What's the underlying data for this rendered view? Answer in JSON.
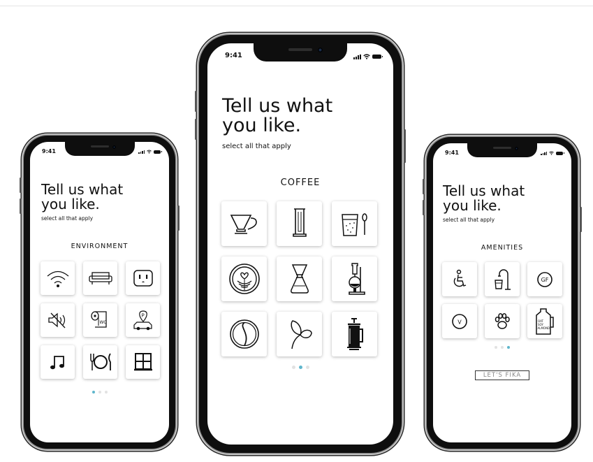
{
  "phones": {
    "left": {
      "time": "9:41",
      "title_line1": "Tell us what",
      "title_line2": "you like.",
      "subtitle": "select all that apply",
      "section": "ENVIRONMENT",
      "icons": [
        "wifi-icon",
        "sofa-icon",
        "outlet-icon",
        "mute-icon",
        "toilet-paper-icon",
        "parking-icon",
        "music-note-icon",
        "dining-icon",
        "window-icon"
      ],
      "wc_text": "WC",
      "parking_text": "P",
      "page": 1,
      "pages": 3
    },
    "center": {
      "time": "9:41",
      "title_line1": "Tell us what",
      "title_line2": "you like.",
      "subtitle": "select all that apply",
      "section": "COFFEE",
      "icons": [
        "pour-over-icon",
        "aeropress-icon",
        "cold-brew-icon",
        "latte-art-icon",
        "chemex-icon",
        "siphon-icon",
        "yin-yang-bean-icon",
        "coffee-leaf-icon",
        "french-press-icon"
      ],
      "page": 2,
      "pages": 3
    },
    "right": {
      "time": "9:41",
      "title_line1": "Tell us what",
      "title_line2": "you like.",
      "subtitle": "select all that apply",
      "section": "AMENITIES",
      "icons": [
        "accessible-icon",
        "water-tap-icon",
        "gluten-free-icon",
        "vegan-icon",
        "pet-friendly-icon",
        "alt-milk-icon"
      ],
      "gf_text": "GF",
      "vegan_text": "V",
      "milk_lines": [
        "OAT",
        "SOY",
        "ALMOND"
      ],
      "page": 3,
      "pages": 3,
      "button": "LET'S FIKA"
    }
  },
  "colors": {
    "accent_dot": "#5fb6cc",
    "inactive_dot": "#e2e2e2",
    "ink": "#111111"
  }
}
